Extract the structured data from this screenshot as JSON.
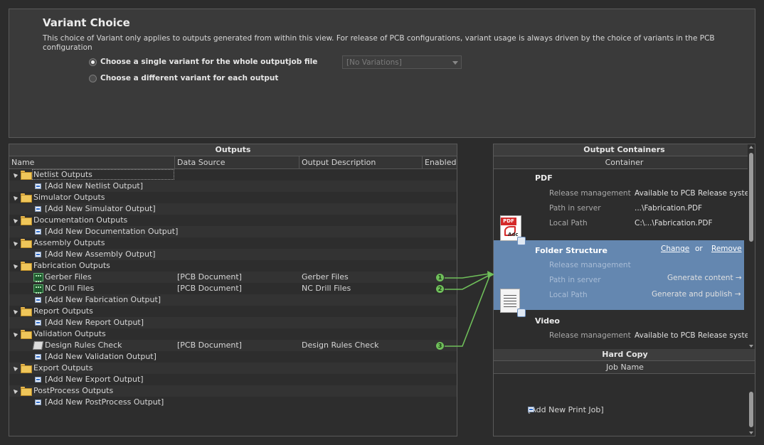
{
  "variant": {
    "title": "Variant Choice",
    "description": "This choice of Variant only applies to outputs generated from within this view. For release of PCB configurations, variant usage is always driven by the choice of variants in the PCB configuration",
    "options": [
      {
        "label": "Choose a single variant for the whole outputjob file",
        "selected": true
      },
      {
        "label": "Choose a different variant for each output",
        "selected": false
      }
    ],
    "select_value": "[No Variations]"
  },
  "outputs": {
    "title": "Outputs",
    "columns": [
      "Name",
      "Data Source",
      "Output Description",
      "Enabled"
    ],
    "rows": [
      {
        "type": "group",
        "name": "Netlist Outputs"
      },
      {
        "type": "add",
        "name": "[Add New Netlist Output]"
      },
      {
        "type": "group",
        "name": "Simulator Outputs"
      },
      {
        "type": "add",
        "name": "[Add New Simulator Output]"
      },
      {
        "type": "group",
        "name": "Documentation Outputs"
      },
      {
        "type": "add",
        "name": "[Add New Documentation Output]"
      },
      {
        "type": "group",
        "name": "Assembly Outputs"
      },
      {
        "type": "add",
        "name": "[Add New Assembly Output]"
      },
      {
        "type": "group",
        "name": "Fabrication Outputs"
      },
      {
        "type": "item",
        "icon": "gerber",
        "name": "Gerber Files",
        "source": "[PCB Document]",
        "desc": "Gerber Files",
        "enabled": "1"
      },
      {
        "type": "item",
        "icon": "gerber",
        "name": "NC Drill Files",
        "source": "[PCB Document]",
        "desc": "NC Drill Files",
        "enabled": "2"
      },
      {
        "type": "add",
        "name": "[Add New Fabrication Output]"
      },
      {
        "type": "group",
        "name": "Report Outputs"
      },
      {
        "type": "add",
        "name": "[Add New Report Output]"
      },
      {
        "type": "group",
        "name": "Validation Outputs"
      },
      {
        "type": "item",
        "icon": "drc",
        "name": "Design Rules Check",
        "source": "[PCB Document]",
        "desc": "Design Rules Check",
        "enabled": "3"
      },
      {
        "type": "add",
        "name": "[Add New Validation Output]"
      },
      {
        "type": "group",
        "name": "Export Outputs"
      },
      {
        "type": "add",
        "name": "[Add New Export Output]"
      },
      {
        "type": "group",
        "name": "PostProcess Outputs"
      },
      {
        "type": "add",
        "name": "[Add New PostProcess Output]"
      }
    ]
  },
  "containers": {
    "title": "Output Containers",
    "subheader": "Container",
    "pdf": {
      "title": "PDF",
      "icon_tag": "PDF",
      "icon_text": "Adc",
      "fields": [
        {
          "label": "Release management",
          "value": "Available to PCB Release system"
        },
        {
          "label": "Path in server",
          "value": "...\\Fabrication.PDF"
        },
        {
          "label": "Local Path",
          "value": "C:\\...\\Fabrication.PDF"
        }
      ]
    },
    "folder": {
      "title": "Folder Structure",
      "change": "Change",
      "or": "or",
      "remove": "Remove",
      "fields": [
        {
          "label": "Release management",
          "value": ""
        },
        {
          "label": "Path in server",
          "value": "Generate content →"
        },
        {
          "label": "Local Path",
          "value": "Generate and publish →"
        }
      ]
    },
    "video": {
      "title": "Video",
      "fields": [
        {
          "label": "Release management",
          "value": "Available to PCB Release system"
        }
      ]
    },
    "hardcopy_title": "Hard Copy",
    "job_name_header": "Job Name",
    "add_print_job": "[Add New Print Job]"
  },
  "colors": {
    "selection": "#6487b0",
    "connector": "#6fbf5a",
    "folder": "#efc65a"
  }
}
